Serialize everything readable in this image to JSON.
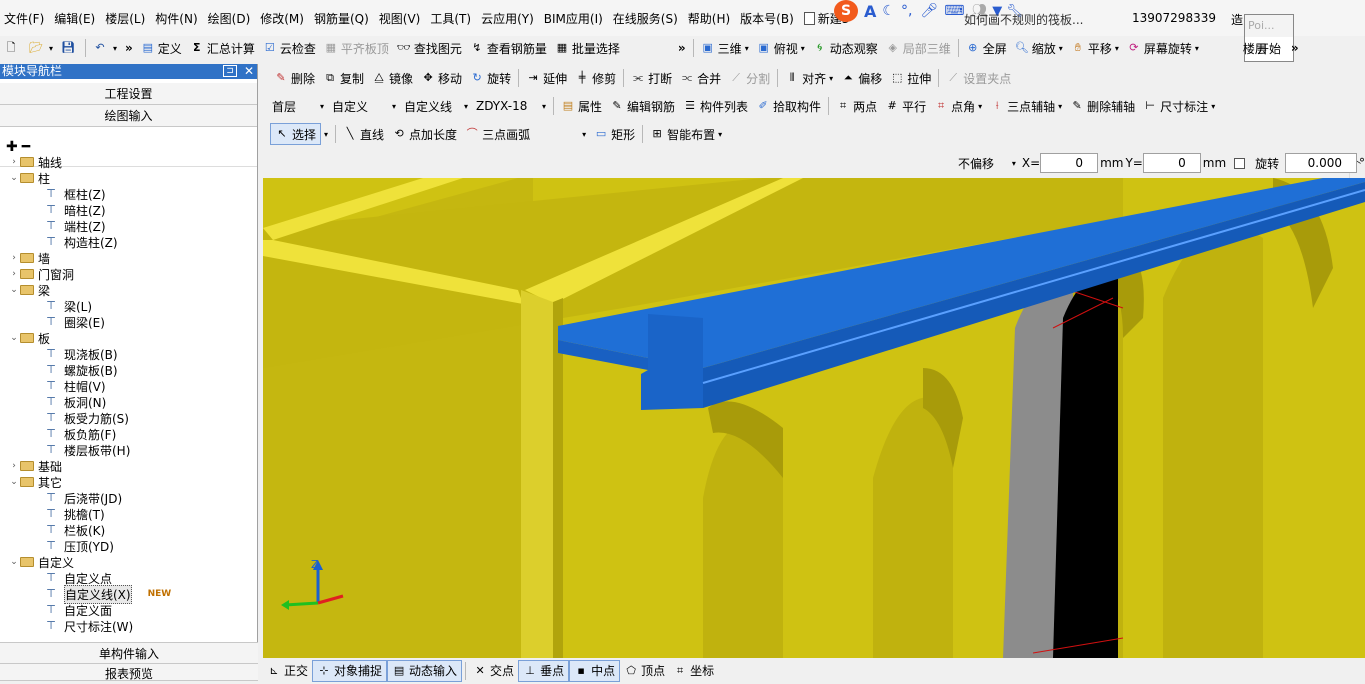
{
  "menu": [
    "文件(F)",
    "编辑(E)",
    "楼层(L)",
    "构件(N)",
    "绘图(D)",
    "修改(M)",
    "钢筋量(Q)",
    "视图(V)",
    "工具(T)",
    "云应用(Y)",
    "BIM应用(I)",
    "在线服务(S)",
    "帮助(H)",
    "版本号(B)"
  ],
  "menu_extra": {
    "new_label": "新建3",
    "ime_logo": "S",
    "ime_A": "A",
    "doc_title": "如何画不规则的筏板...",
    "phone": "13907298339",
    "phone_suffix": "造",
    "popup_title": "Poi...",
    "popup_start": "开始"
  },
  "toolbar1": {
    "define": "定义",
    "sum_calc": "汇总计算",
    "cloud_check": "云检查",
    "level_slab": "平齐板顶",
    "find_element": "查找图元",
    "view_rebar": "查看钢筋量",
    "batch_select": "批量选择",
    "view_3d": "三维",
    "top_view": "俯视",
    "dynamic_view": "动态观察",
    "local_3d": "局部三维",
    "fullscreen": "全屏",
    "zoom": "缩放",
    "pan": "平移",
    "screen_rotate": "屏幕旋转",
    "floor_tail": "楼层"
  },
  "toolbar2": {
    "delete": "删除",
    "copy": "复制",
    "mirror": "镜像",
    "move": "移动",
    "rotate": "旋转",
    "extend": "延伸",
    "trim": "修剪",
    "break": "打断",
    "merge": "合并",
    "split": "分割",
    "align": "对齐",
    "offset": "偏移",
    "stretch": "拉伸",
    "set_grip": "设置夹点"
  },
  "toolbar3": {
    "floor": "首层",
    "custom": "自定义",
    "custom_line": "自定义线",
    "component": "ZDYX-18",
    "properties": "属性",
    "edit_rebar": "编辑钢筋",
    "component_list": "构件列表",
    "pick_component": "拾取构件",
    "two_points": "两点",
    "parallel": "平行",
    "point_angle": "点角",
    "three_point_axis": "三点辅轴",
    "delete_axis": "删除辅轴",
    "dimension": "尺寸标注"
  },
  "toolbar4": {
    "select": "选择",
    "line": "直线",
    "point_length": "点加长度",
    "three_point_arc": "三点画弧",
    "rectangle": "矩形",
    "smart_layout": "智能布置"
  },
  "coords": {
    "offset_mode": "不偏移",
    "x_label": "X=",
    "x_value": "0",
    "x_unit": "mm",
    "y_label": "Y=",
    "y_value": "0",
    "y_unit": "mm",
    "rotate_label": "旋转",
    "rotate_value": "0.000",
    "deg": "°"
  },
  "panel": {
    "title": "模块导航栏",
    "project_settings": "工程设置",
    "drawing_input": "绘图输入",
    "single_input": "单构件输入",
    "report_preview": "报表预览",
    "new_badge": "NEW"
  },
  "tree": [
    {
      "label": "轴线",
      "level": 0,
      "toggle": "›",
      "folder": true
    },
    {
      "label": "柱",
      "level": 0,
      "toggle": "⌄",
      "folder": true
    },
    {
      "label": "框柱(Z)",
      "level": 1
    },
    {
      "label": "暗柱(Z)",
      "level": 1
    },
    {
      "label": "端柱(Z)",
      "level": 1
    },
    {
      "label": "构造柱(Z)",
      "level": 1
    },
    {
      "label": "墙",
      "level": 0,
      "toggle": "›",
      "folder": true
    },
    {
      "label": "门窗洞",
      "level": 0,
      "toggle": "›",
      "folder": true
    },
    {
      "label": "梁",
      "level": 0,
      "toggle": "⌄",
      "folder": true
    },
    {
      "label": "梁(L)",
      "level": 1
    },
    {
      "label": "圈梁(E)",
      "level": 1
    },
    {
      "label": "板",
      "level": 0,
      "toggle": "⌄",
      "folder": true
    },
    {
      "label": "现浇板(B)",
      "level": 1
    },
    {
      "label": "螺旋板(B)",
      "level": 1
    },
    {
      "label": "柱帽(V)",
      "level": 1
    },
    {
      "label": "板洞(N)",
      "level": 1
    },
    {
      "label": "板受力筋(S)",
      "level": 1
    },
    {
      "label": "板负筋(F)",
      "level": 1
    },
    {
      "label": "楼层板带(H)",
      "level": 1
    },
    {
      "label": "基础",
      "level": 0,
      "toggle": "›",
      "folder": true
    },
    {
      "label": "其它",
      "level": 0,
      "toggle": "⌄",
      "folder": true
    },
    {
      "label": "后浇带(JD)",
      "level": 1
    },
    {
      "label": "挑檐(T)",
      "level": 1
    },
    {
      "label": "栏板(K)",
      "level": 1
    },
    {
      "label": "压顶(YD)",
      "level": 1
    },
    {
      "label": "自定义",
      "level": 0,
      "toggle": "⌄",
      "folder": true
    },
    {
      "label": "自定义点",
      "level": 1
    },
    {
      "label": "自定义线(X)",
      "level": 1,
      "selected": true
    },
    {
      "label": "自定义面",
      "level": 1
    },
    {
      "label": "尺寸标注(W)",
      "level": 1
    }
  ],
  "status": {
    "ortho": "正交",
    "snap": "对象捕捉",
    "dynamic_input": "动态输入",
    "intersection": "交点",
    "perpendicular": "垂点",
    "midpoint": "中点",
    "vertex": "顶点",
    "coordinate": "坐标"
  },
  "axes": {
    "z": "Z"
  },
  "colors": {
    "wall": "#cfc212",
    "beam": "#1f6fd6",
    "accent_blue": "#3072c6",
    "hole": "#000000"
  }
}
